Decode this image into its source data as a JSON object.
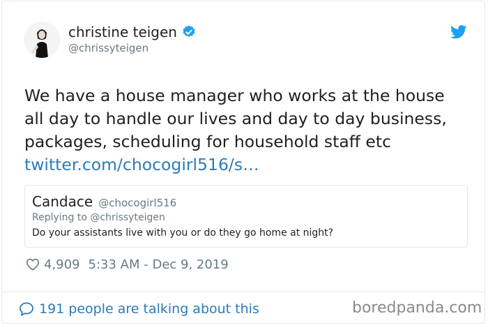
{
  "author": {
    "name": "christine teigen",
    "handle": "@chrissyteigen"
  },
  "tweet": {
    "lines": [
      "We have a house manager who works at the house",
      "all day to handle our lives and day to day business,",
      "packages, scheduling for household staff etc"
    ],
    "link": "twitter.com/chocogirl516/s…"
  },
  "quoted": {
    "name": "Candace",
    "handle": "@chocogirl516",
    "reply_to": "Replying to @chrissyteigen",
    "text": "Do your assistants live with you or do they go home at night?"
  },
  "meta": {
    "likes": "4,909",
    "timestamp": "5:33 AM - Dec 9, 2019"
  },
  "footer": {
    "talking": "191 people are talking about this"
  },
  "watermark": "boredpanda.com",
  "colors": {
    "link": "#2b7bb9",
    "verified": "#1da1f2",
    "twitter_bird": "#1da1f2",
    "secondary_text": "#697882",
    "border": "#e1e8ed"
  },
  "icons": [
    "verified-badge-icon",
    "twitter-bird-icon",
    "heart-icon",
    "speech-bubble-icon"
  ]
}
